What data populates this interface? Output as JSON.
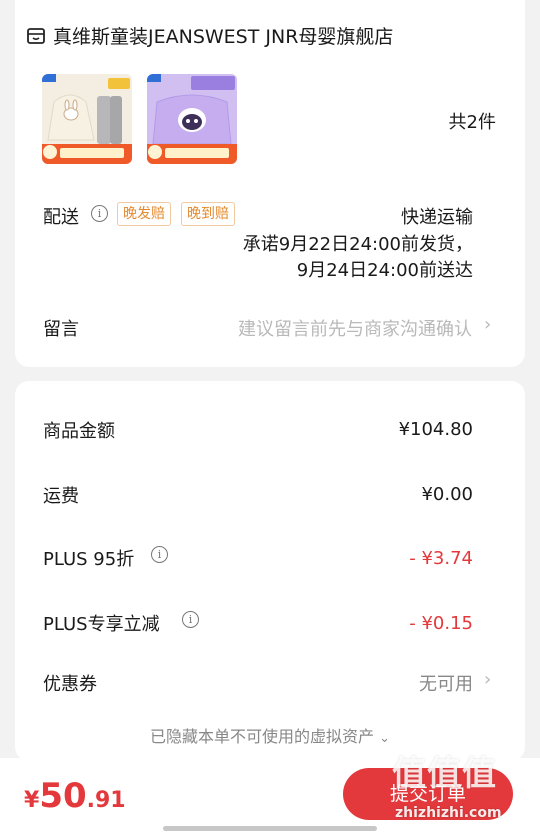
{
  "shop": {
    "icon": "store-icon",
    "name": "真维斯童装JEANSWEST JNR母婴旗舰店",
    "product_count": "共2件",
    "products": [
      {
        "image": "beige bunny sweatshirt with grey pants",
        "badge": "真五折限时补贴"
      },
      {
        "image": "purple cartoon sweatshirt",
        "badge": "真五折限时补贴"
      }
    ]
  },
  "delivery": {
    "label": "配送",
    "tags": [
      "晚发赔",
      "晚到赔"
    ],
    "method": "快递运输",
    "promise_line1": "承诺9月22日24:00前发货，",
    "promise_line2": "9月24日24:00前送达"
  },
  "message": {
    "label": "留言",
    "placeholder": "建议留言前先与商家沟通确认"
  },
  "price": {
    "goods_label": "商品金额",
    "goods_value": "¥104.80",
    "shipping_label": "运费",
    "shipping_value": "¥0.00",
    "plus95_label": "PLUS 95折",
    "plus95_value": "- ¥3.74",
    "plus_discount_label": "PLUS专享立减",
    "plus_discount_value": "- ¥0.15",
    "coupon_label": "优惠券",
    "coupon_value": "无可用"
  },
  "hidden_note": "已隐藏本单不可使用的虚拟资产",
  "footer": {
    "currency": "¥",
    "total_int": "50",
    "total_dec": ".91",
    "submit_label": "提交订单"
  },
  "watermark": {
    "text": "值值值",
    "url": "zhizhizhi.com"
  },
  "colors": {
    "accent": "#e4393c",
    "tag": "#e58a2e",
    "muted": "#888888"
  }
}
